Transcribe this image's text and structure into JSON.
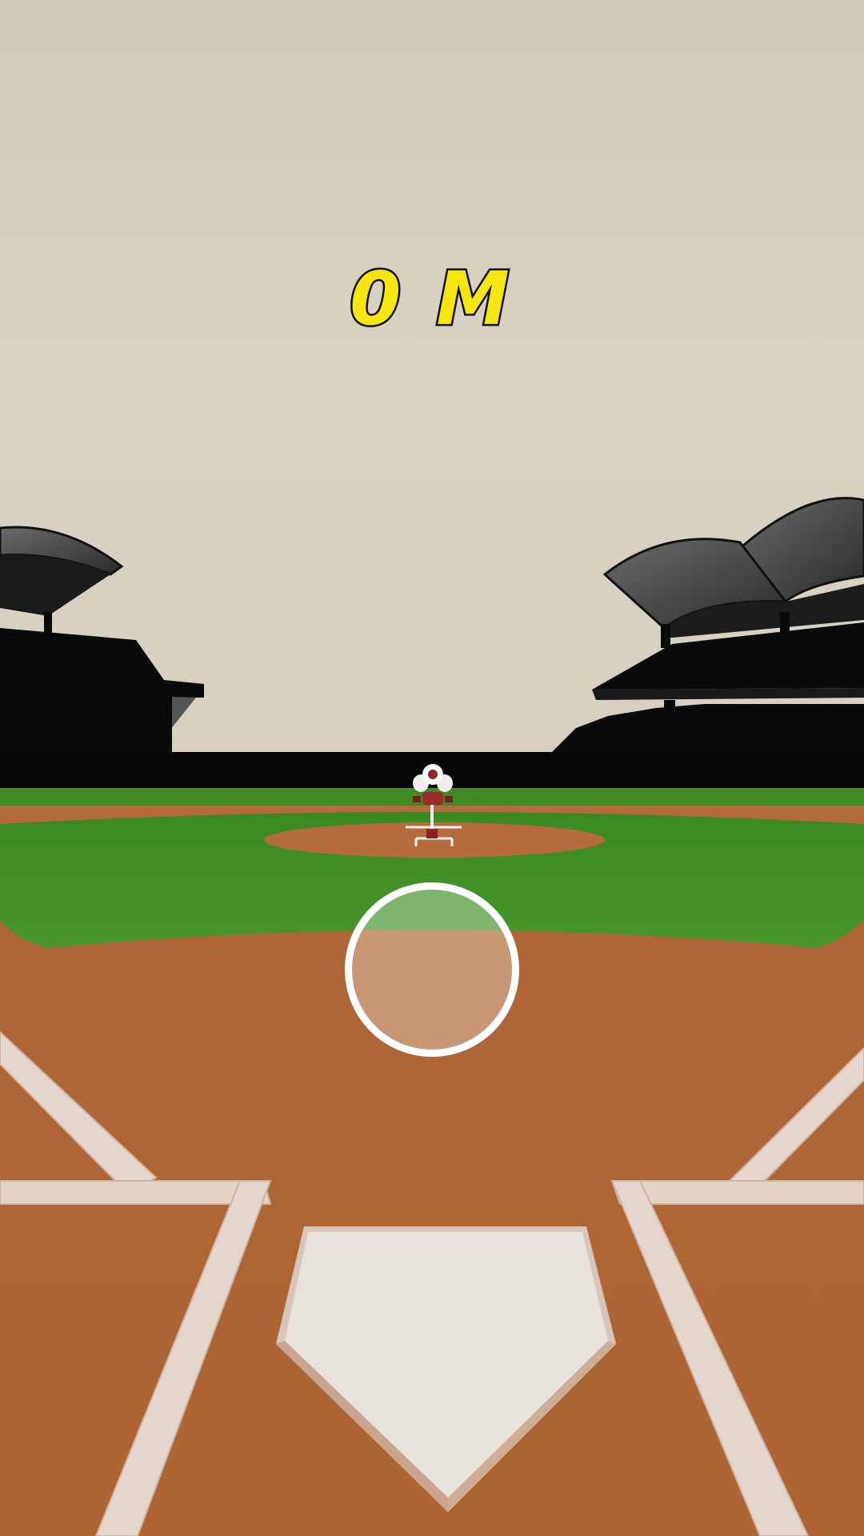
{
  "hud": {
    "distance_value": "0",
    "distance_unit": "M"
  },
  "colors": {
    "distance_text": "#f6e50f",
    "distance_outline": "#111111",
    "sky": "#d8d1c1",
    "grass": "#3f8b24",
    "dirt": "#b56a3a",
    "chalk": "#e4d6cc",
    "stands": "#0a0a0a"
  },
  "scene": {
    "objects": [
      "stadium-stands-left",
      "stadium-stands-right",
      "outfield-wall",
      "pitching-machine",
      "pitchers-mound",
      "home-plate",
      "batters-box-left",
      "batters-box-right"
    ],
    "controls": [
      "swing-button"
    ]
  }
}
